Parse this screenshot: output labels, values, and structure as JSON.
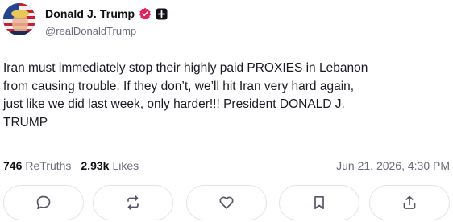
{
  "author": {
    "display_name": "Donald J. Trump",
    "handle": "@realDonaldTrump",
    "avatar_icon": "avatar-flag-portrait",
    "verified_icon": "verified-badge-icon",
    "verified_color": "#e0245e",
    "plus_icon": "plus-square-icon"
  },
  "post": {
    "text": "Iran must immediately stop their highly paid PROXIES in Lebanon\nfrom causing trouble. If they don’t, we’ll hit Iran very hard again,\njust like we did last week, only harder!!! President  DONALD J.\nTRUMP"
  },
  "stats": {
    "retruths_count": "746",
    "retruths_label": "ReTruths",
    "likes_count": "2.93k",
    "likes_label": "Likes",
    "timestamp": "Jun 21, 2026, 4:30 PM"
  },
  "actions": [
    {
      "name": "reply-button",
      "icon": "comment-icon"
    },
    {
      "name": "retruth-button",
      "icon": "retruth-icon"
    },
    {
      "name": "like-button",
      "icon": "heart-icon"
    },
    {
      "name": "bookmark-button",
      "icon": "bookmark-icon"
    },
    {
      "name": "share-button",
      "icon": "share-icon"
    }
  ],
  "colors": {
    "text": "#1a1a22",
    "muted": "#6b6b7b",
    "border": "#e3e3ea",
    "icon": "#55556a"
  }
}
